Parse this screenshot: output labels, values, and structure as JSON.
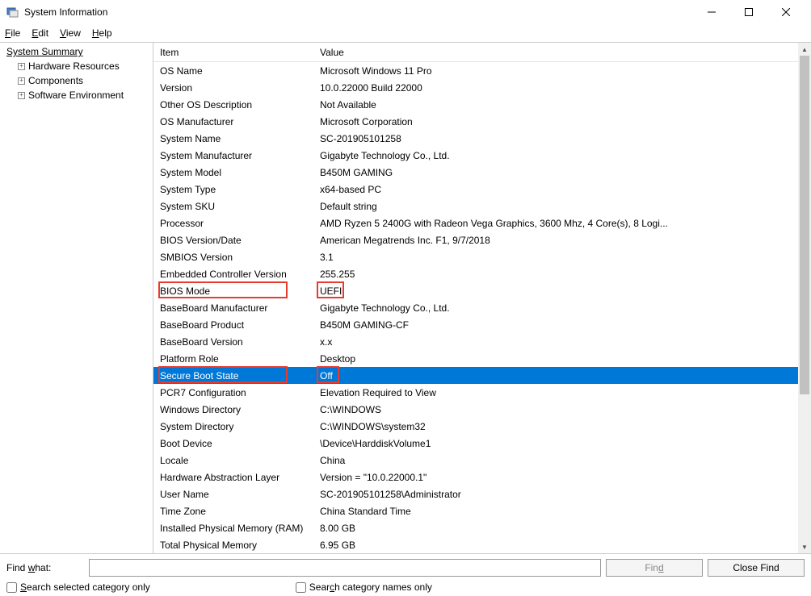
{
  "window": {
    "title": "System Information"
  },
  "menu": {
    "file": "File",
    "edit": "Edit",
    "view": "View",
    "help": "Help"
  },
  "tree": {
    "root": "System Summary",
    "children": [
      "Hardware Resources",
      "Components",
      "Software Environment"
    ]
  },
  "list": {
    "header_item": "Item",
    "header_value": "Value",
    "rows": [
      {
        "item": "OS Name",
        "value": "Microsoft Windows 11 Pro"
      },
      {
        "item": "Version",
        "value": "10.0.22000 Build 22000"
      },
      {
        "item": "Other OS Description",
        "value": "Not Available"
      },
      {
        "item": "OS Manufacturer",
        "value": "Microsoft Corporation"
      },
      {
        "item": "System Name",
        "value": "SC-201905101258"
      },
      {
        "item": "System Manufacturer",
        "value": "Gigabyte Technology Co., Ltd."
      },
      {
        "item": "System Model",
        "value": "B450M GAMING"
      },
      {
        "item": "System Type",
        "value": "x64-based PC"
      },
      {
        "item": "System SKU",
        "value": "Default string"
      },
      {
        "item": "Processor",
        "value": "AMD Ryzen 5 2400G with Radeon Vega Graphics, 3600 Mhz, 4 Core(s), 8 Logi..."
      },
      {
        "item": "BIOS Version/Date",
        "value": "American Megatrends Inc. F1, 9/7/2018"
      },
      {
        "item": "SMBIOS Version",
        "value": "3.1"
      },
      {
        "item": "Embedded Controller Version",
        "value": "255.255"
      },
      {
        "item": "BIOS Mode",
        "value": "UEFI"
      },
      {
        "item": "BaseBoard Manufacturer",
        "value": "Gigabyte Technology Co., Ltd."
      },
      {
        "item": "BaseBoard Product",
        "value": "B450M GAMING-CF"
      },
      {
        "item": "BaseBoard Version",
        "value": "x.x"
      },
      {
        "item": "Platform Role",
        "value": "Desktop"
      },
      {
        "item": "Secure Boot State",
        "value": "Off"
      },
      {
        "item": "PCR7 Configuration",
        "value": "Elevation Required to View"
      },
      {
        "item": "Windows Directory",
        "value": "C:\\WINDOWS"
      },
      {
        "item": "System Directory",
        "value": "C:\\WINDOWS\\system32"
      },
      {
        "item": "Boot Device",
        "value": "\\Device\\HarddiskVolume1"
      },
      {
        "item": "Locale",
        "value": "China"
      },
      {
        "item": "Hardware Abstraction Layer",
        "value": "Version = \"10.0.22000.1\""
      },
      {
        "item": "User Name",
        "value": "SC-201905101258\\Administrator"
      },
      {
        "item": "Time Zone",
        "value": "China Standard Time"
      },
      {
        "item": "Installed Physical Memory (RAM)",
        "value": "8.00 GB"
      },
      {
        "item": "Total Physical Memory",
        "value": "6.95 GB"
      }
    ],
    "selected_index": 18,
    "highlights": [
      {
        "row_index": 13,
        "item_width": 160,
        "value_offset": 198,
        "value_width": 34
      },
      {
        "row_index": 18,
        "item_width": 160,
        "value_offset": 198,
        "value_width": 28
      }
    ]
  },
  "find": {
    "label": "Find what:",
    "value": "",
    "find_btn": "Find",
    "close_btn": "Close Find",
    "check_selected": "Search selected category only",
    "check_names": "Search category names only"
  }
}
